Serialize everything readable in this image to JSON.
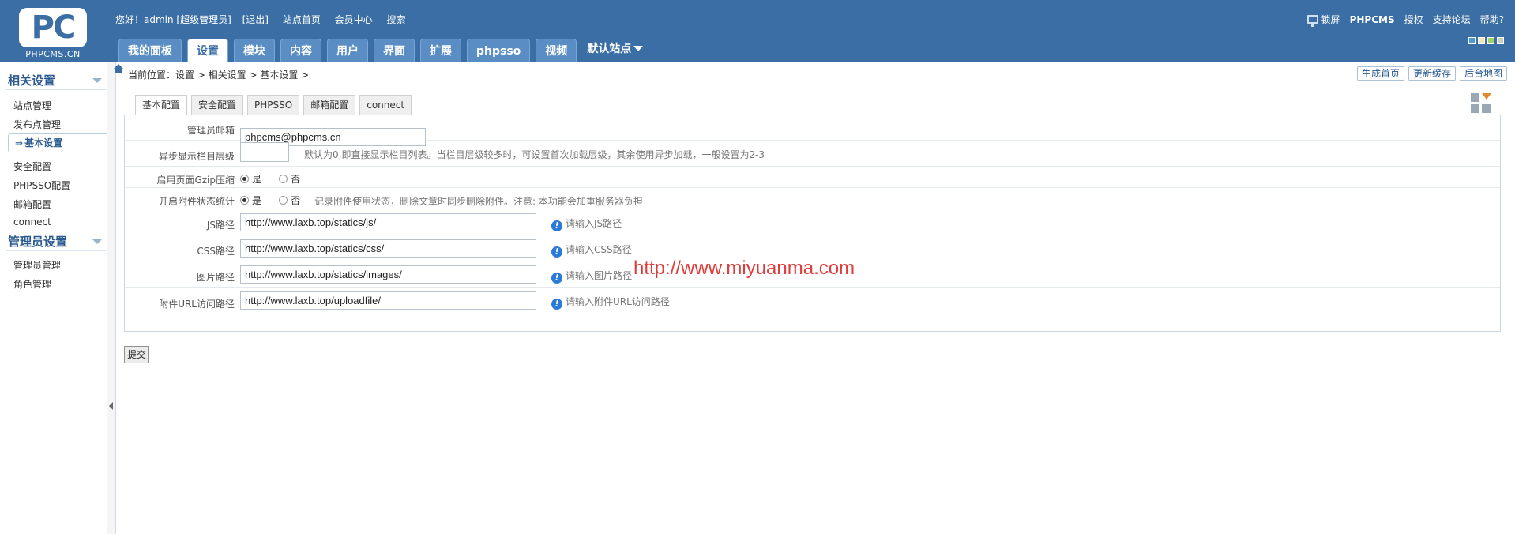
{
  "logo": {
    "text": "PC",
    "sub": "PHPCMS.CN"
  },
  "top": {
    "greeting": "您好！admin [超级管理员]",
    "links": [
      "[退出]",
      "站点首页",
      "会员中心",
      "搜索"
    ],
    "right": [
      "锁屏",
      "PHPCMS",
      "授权",
      "支持论坛",
      "帮助?"
    ],
    "theme_colors": [
      "#4b9bd8",
      "#f0e6b8",
      "#9fd267",
      "#cccccc"
    ]
  },
  "nav": {
    "tabs": [
      "我的面板",
      "设置",
      "模块",
      "内容",
      "用户",
      "界面",
      "扩展",
      "phpsso",
      "视频"
    ],
    "active": "设置",
    "site": "默认站点"
  },
  "sidebar": {
    "sections": [
      {
        "title": "相关设置",
        "items": [
          "站点管理",
          "发布点管理",
          "基本设置",
          "安全配置",
          "PHPSSO配置",
          "邮箱配置",
          "connect"
        ]
      },
      {
        "title": "管理员设置",
        "items": [
          "管理员管理",
          "角色管理"
        ]
      }
    ],
    "active_arrow": "⇒"
  },
  "breadcrumb": "当前位置：设置 > 相关设置 > 基本设置 >",
  "quick_buttons": [
    "生成首页",
    "更新缓存",
    "后台地图"
  ],
  "subtabs": [
    "基本配置",
    "安全配置",
    "PHPSSO",
    "邮箱配置",
    "connect"
  ],
  "form": {
    "admin_email": {
      "label": "管理员邮箱",
      "value": "phpcms@phpcms.cn"
    },
    "async_level": {
      "label": "异步显示栏目层级",
      "value": "",
      "hint": "默认为0,即直接显示栏目列表。当栏目层级较多时，可设置首次加载层级，其余使用异步加载，一般设置为2-3"
    },
    "gzip": {
      "label": "启用页面Gzip压缩",
      "yes": "是",
      "no": "否"
    },
    "attach_stat": {
      "label": "开启附件状态统计",
      "yes": "是",
      "no": "否",
      "hint": "记录附件使用状态，删除文章时同步删除附件。注意: 本功能会加重服务器负担"
    },
    "js_path": {
      "label": "JS路径",
      "value": "http://www.laxb.top/statics/js/",
      "tip": "请输入JS路径"
    },
    "css_path": {
      "label": "CSS路径",
      "value": "http://www.laxb.top/statics/css/",
      "tip": "请输入CSS路径"
    },
    "img_path": {
      "label": "图片路径",
      "value": "http://www.laxb.top/statics/images/",
      "tip": "请输入图片路径"
    },
    "upload_url": {
      "label": "附件URL访问路径",
      "value": "http://www.laxb.top/uploadfile/",
      "tip": "请输入附件URL访问路径"
    }
  },
  "submit_label": "提交",
  "watermark": "http://www.miyuanma.com"
}
